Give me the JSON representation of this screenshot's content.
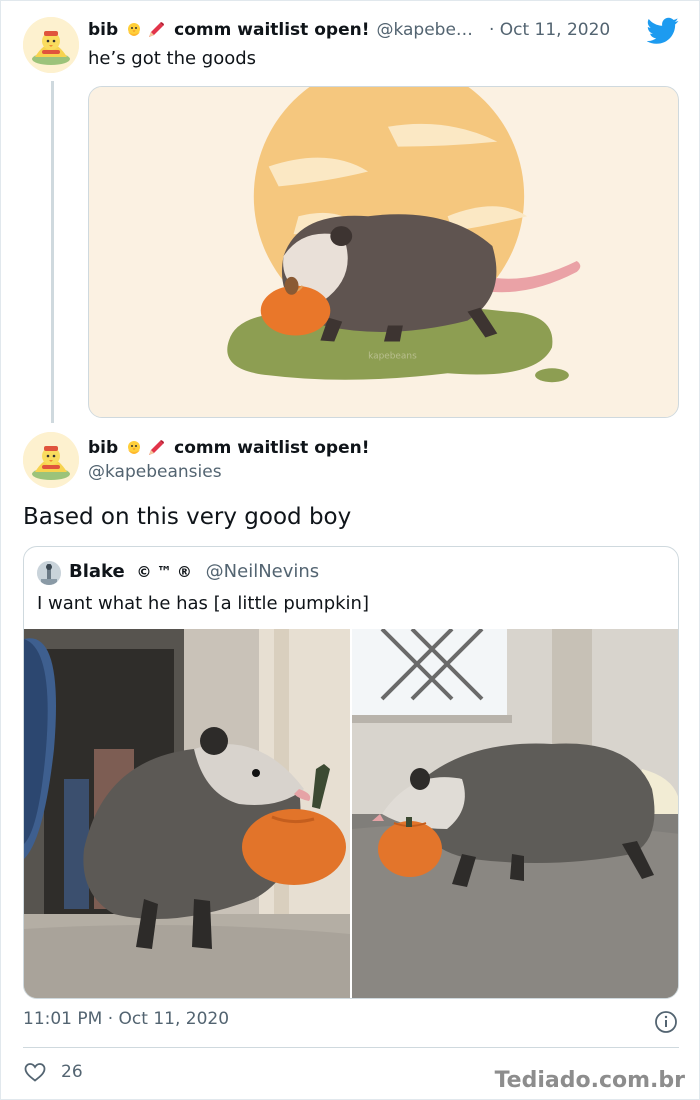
{
  "reply_tweet": {
    "display_name": "bib",
    "name_suffix": "comm waitlist open!",
    "handle": "@kapebe…",
    "date": "· Oct 11, 2020",
    "text": "he’s got the goods",
    "media_signature": "kapebeans"
  },
  "main_tweet": {
    "display_name": "bib",
    "name_suffix": "comm waitlist open!",
    "handle": "@kapebeansies",
    "text": "Based on this very good boy",
    "timestamp": "11:01 PM · Oct 11, 2020",
    "like_count": "26"
  },
  "quoted_tweet": {
    "display_name": "Blake",
    "name_symbols": "© ™ ®",
    "handle": "@NeilNevins",
    "text": "I want what he has [a little pumpkin]"
  },
  "watermark": "Tediado.com.br",
  "colors": {
    "twitter_blue": "#1d9bf0",
    "muted_text": "#536471",
    "border": "#cfd9de",
    "pumpkin": "#e9772a"
  },
  "icons": {
    "bird": "twitter-bird-icon",
    "chick": "chick-emoji-icon",
    "pencil": "pencil-emoji-icon",
    "info": "info-icon",
    "heart": "heart-icon"
  }
}
